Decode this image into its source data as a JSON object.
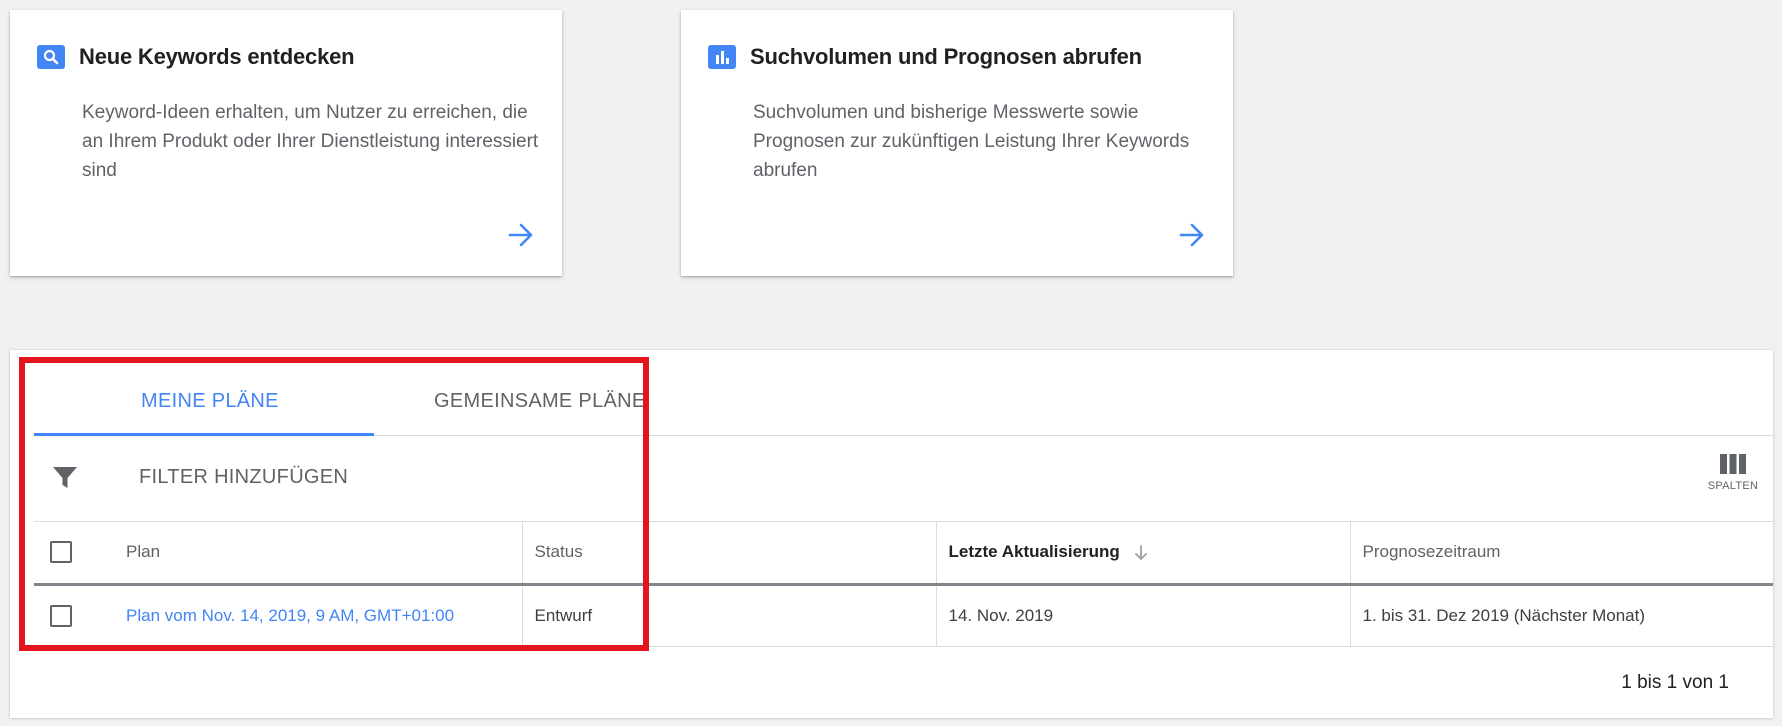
{
  "cards": [
    {
      "icon": "search-icon",
      "title": "Neue Keywords entdecken",
      "description": "Keyword-Ideen erhalten, um Nutzer zu erreichen, die an Ihrem Produkt oder Ihrer Dienstleistung interessiert sind"
    },
    {
      "icon": "bar-chart-icon",
      "title": "Suchvolumen und Prognosen abrufen",
      "description": "Suchvolumen und bisherige Messwerte sowie Prognosen zur zukünftigen Leistung Ihrer Keywords abrufen"
    }
  ],
  "tabs": {
    "active": "MEINE PLÄNE",
    "inactive": "GEMEINSAME PLÄNE"
  },
  "toolbar": {
    "filter_label": "FILTER HINZUFÜGEN",
    "columns_label": "SPALTEN"
  },
  "table": {
    "headers": {
      "plan": "Plan",
      "status": "Status",
      "updated": "Letzte Aktualisierung",
      "forecast": "Prognosezeitraum"
    },
    "rows": [
      {
        "plan": "Plan vom Nov. 14, 2019, 9 AM, GMT+01:00",
        "status": "Entwurf",
        "updated": "14. Nov. 2019",
        "forecast": "1. bis 31. Dez 2019 (Nächster Monat)"
      }
    ]
  },
  "pagination": "1 bis 1 von 1",
  "colors": {
    "accent": "#4285f4",
    "highlight": "#e3141e"
  }
}
